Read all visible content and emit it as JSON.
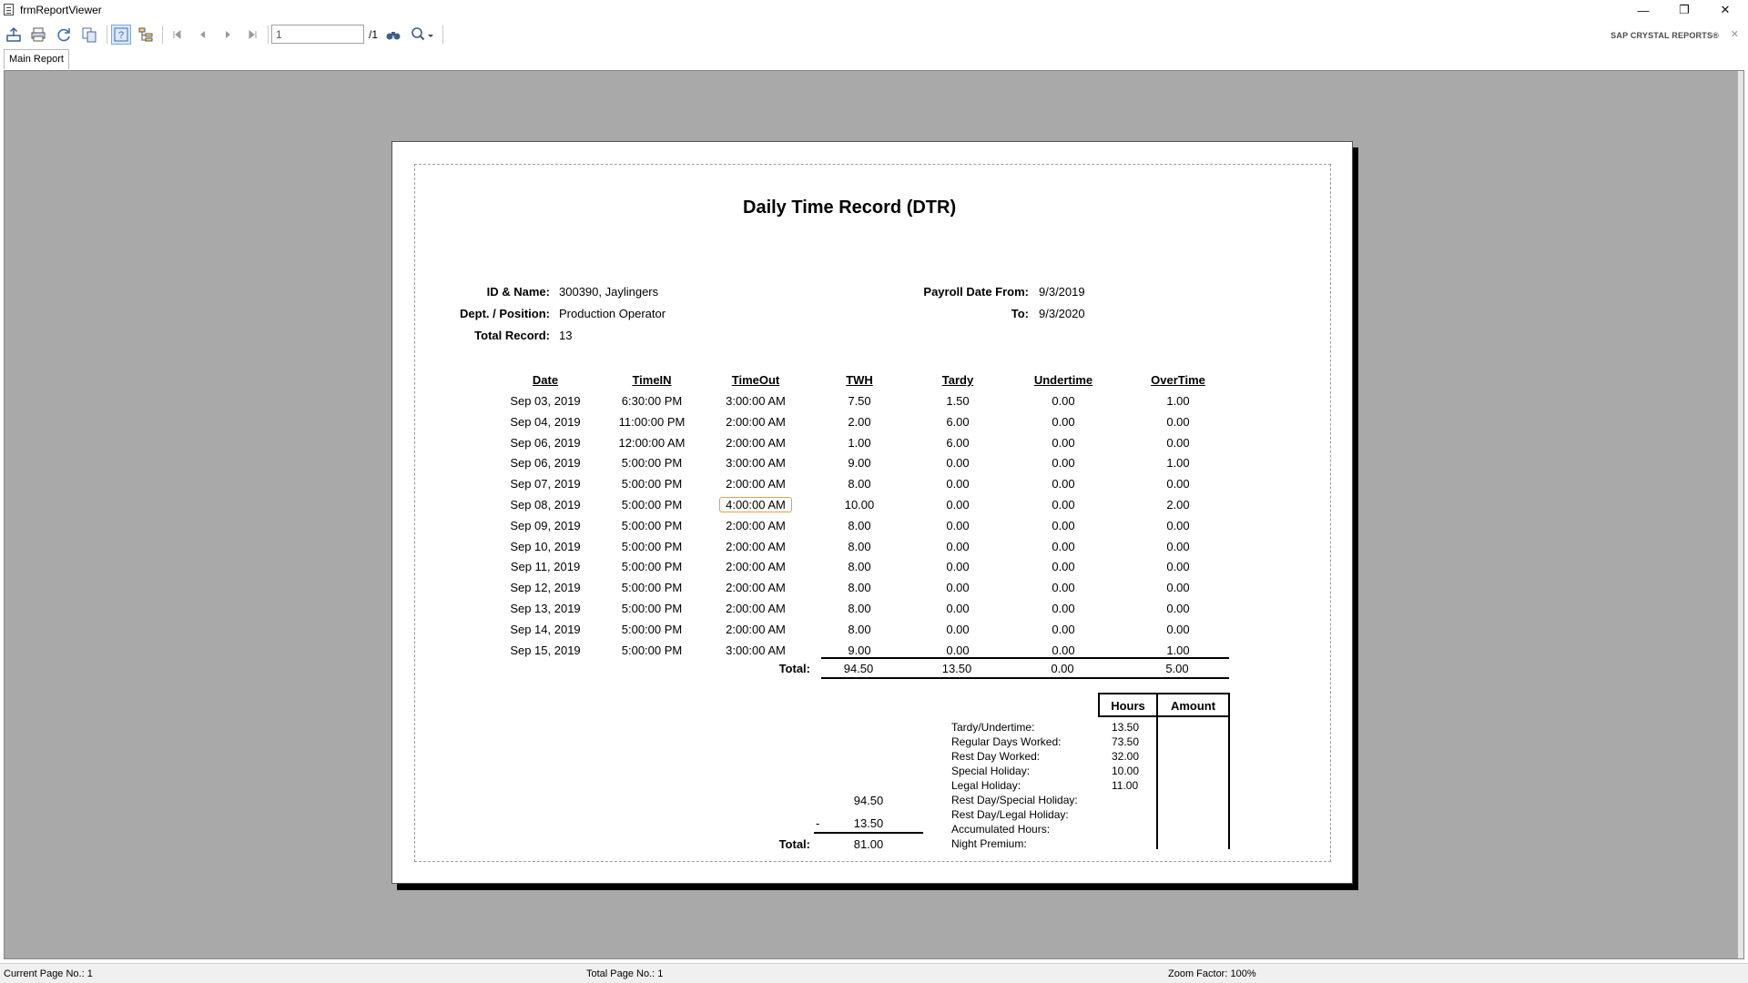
{
  "window": {
    "title": "frmReportViewer",
    "minimize": "—",
    "restore": "❐",
    "close": "✕"
  },
  "toolbar": {
    "page_value": "1",
    "page_total": "/1",
    "brand": "SAP CRYSTAL REPORTS®",
    "brand_close": "✕"
  },
  "tabs": [
    {
      "label": "Main Report"
    }
  ],
  "report": {
    "title": "Daily Time Record (DTR)",
    "header": {
      "id_label": "ID & Name:",
      "id_value": "300390, Jaylingers",
      "dept_label": "Dept. / Position:",
      "dept_value": "Production Operator",
      "total_label": "Total Record:",
      "total_value": "13",
      "payroll_from_label": "Payroll Date From:",
      "payroll_from_value": "9/3/2019",
      "to_label": "To:",
      "to_value": "9/3/2020"
    },
    "columns": [
      "Date",
      "TimeIN",
      "TimeOut",
      "TWH",
      "Tardy",
      "Undertime",
      "OverTime"
    ],
    "rows": [
      [
        "Sep 03, 2019",
        "6:30:00 PM",
        "3:00:00 AM",
        "7.50",
        "1.50",
        "0.00",
        "1.00"
      ],
      [
        "Sep 04, 2019",
        "11:00:00 PM",
        "2:00:00 AM",
        "2.00",
        "6.00",
        "0.00",
        "0.00"
      ],
      [
        "Sep 06, 2019",
        "12:00:00 AM",
        "2:00:00 AM",
        "1.00",
        "6.00",
        "0.00",
        "0.00"
      ],
      [
        "Sep 06, 2019",
        "5:00:00 PM",
        "3:00:00 AM",
        "9.00",
        "0.00",
        "0.00",
        "1.00"
      ],
      [
        "Sep 07, 2019",
        "5:00:00 PM",
        "2:00:00 AM",
        "8.00",
        "0.00",
        "0.00",
        "0.00"
      ],
      [
        "Sep 08, 2019",
        "5:00:00 PM",
        "4:00:00 AM",
        "10.00",
        "0.00",
        "0.00",
        "2.00"
      ],
      [
        "Sep 09, 2019",
        "5:00:00 PM",
        "2:00:00 AM",
        "8.00",
        "0.00",
        "0.00",
        "0.00"
      ],
      [
        "Sep 10, 2019",
        "5:00:00 PM",
        "2:00:00 AM",
        "8.00",
        "0.00",
        "0.00",
        "0.00"
      ],
      [
        "Sep 11, 2019",
        "5:00:00 PM",
        "2:00:00 AM",
        "8.00",
        "0.00",
        "0.00",
        "0.00"
      ],
      [
        "Sep 12, 2019",
        "5:00:00 PM",
        "2:00:00 AM",
        "8.00",
        "0.00",
        "0.00",
        "0.00"
      ],
      [
        "Sep 13, 2019",
        "5:00:00 PM",
        "2:00:00 AM",
        "8.00",
        "0.00",
        "0.00",
        "0.00"
      ],
      [
        "Sep 14, 2019",
        "5:00:00 PM",
        "2:00:00 AM",
        "8.00",
        "0.00",
        "0.00",
        "0.00"
      ],
      [
        "Sep 15, 2019",
        "5:00:00 PM",
        "3:00:00 AM",
        "9.00",
        "0.00",
        "0.00",
        "1.00"
      ]
    ],
    "totals": {
      "label": "Total:",
      "twh": "94.50",
      "tardy": "13.50",
      "undertime": "0.00",
      "overtime": "5.00"
    },
    "calc": {
      "twh": "94.50",
      "minus_sign": "-",
      "deduction": "13.50",
      "total_label": "Total:",
      "total": "81.00"
    },
    "summary": {
      "hours_header": "Hours",
      "amount_header": "Amount",
      "items": [
        {
          "label": "Tardy/Undertime:",
          "hours": "13.50"
        },
        {
          "label": "Regular Days Worked:",
          "hours": "73.50"
        },
        {
          "label": "Rest Day Worked:",
          "hours": "32.00"
        },
        {
          "label": "Special Holiday:",
          "hours": "10.00"
        },
        {
          "label": "Legal Holiday:",
          "hours": "11.00"
        },
        {
          "label": "Rest Day/Special Holiday:",
          "hours": ""
        },
        {
          "label": "Rest Day/Legal Holiday:",
          "hours": ""
        },
        {
          "label": "Accumulated Hours:",
          "hours": ""
        },
        {
          "label": "Night Premium:",
          "hours": ""
        }
      ]
    }
  },
  "status": {
    "current_page": "Current Page No.: 1",
    "total_page": "Total Page No.: 1",
    "zoom": "Zoom Factor: 100%"
  }
}
